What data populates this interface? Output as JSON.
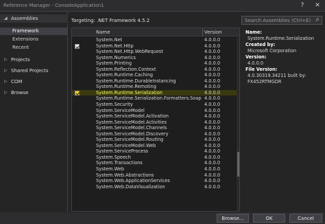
{
  "window": {
    "title": "Reference Manager - ConsoleApplication1",
    "help_glyph": "?",
    "close_glyph": "✕"
  },
  "sidebar": {
    "assemblies": {
      "label": "Assemblies",
      "items": [
        "Framework",
        "Extensions",
        "Recent"
      ],
      "selected": "Framework"
    },
    "groups": [
      "Projects",
      "Shared Projects",
      "COM",
      "Browse"
    ]
  },
  "main": {
    "targeting": "Targeting: .NET Framework 4.5.2",
    "search_placeholder": "Search Assemblies (Ctrl+E)",
    "columns": {
      "name": "Name",
      "version": "Version"
    },
    "rows": [
      {
        "name": "System.Net",
        "version": "4.0.0.0",
        "checked": false,
        "selected": false
      },
      {
        "name": "System.Net.Http",
        "version": "4.0.0.0",
        "checked": true,
        "selected": false
      },
      {
        "name": "System.Net.Http.WebRequest",
        "version": "4.0.0.0",
        "checked": false,
        "selected": false
      },
      {
        "name": "System.Numerics",
        "version": "4.0.0.0",
        "checked": false,
        "selected": false
      },
      {
        "name": "System.Printing",
        "version": "4.0.0.0",
        "checked": false,
        "selected": false
      },
      {
        "name": "System.Reflection.Context",
        "version": "4.0.0.0",
        "checked": false,
        "selected": false
      },
      {
        "name": "System.Runtime.Caching",
        "version": "4.0.0.0",
        "checked": false,
        "selected": false
      },
      {
        "name": "System.Runtime.DurableInstancing",
        "version": "4.0.0.0",
        "checked": false,
        "selected": false
      },
      {
        "name": "System.Runtime.Remoting",
        "version": "4.0.0.0",
        "checked": false,
        "selected": false
      },
      {
        "name": "System.Runtime.Serialization",
        "version": "4.0.0.0",
        "checked": true,
        "selected": true
      },
      {
        "name": "System.Runtime.Serialization.Formatters.Soap",
        "version": "4.0.0.0",
        "checked": false,
        "selected": false
      },
      {
        "name": "System.Security",
        "version": "4.0.0.0",
        "checked": false,
        "selected": false
      },
      {
        "name": "System.ServiceModel",
        "version": "4.0.0.0",
        "checked": false,
        "selected": false
      },
      {
        "name": "System.ServiceModel.Activation",
        "version": "4.0.0.0",
        "checked": false,
        "selected": false
      },
      {
        "name": "System.ServiceModel.Activities",
        "version": "4.0.0.0",
        "checked": false,
        "selected": false
      },
      {
        "name": "System.ServiceModel.Channels",
        "version": "4.0.0.0",
        "checked": false,
        "selected": false
      },
      {
        "name": "System.ServiceModel.Discovery",
        "version": "4.0.0.0",
        "checked": false,
        "selected": false
      },
      {
        "name": "System.ServiceModel.Routing",
        "version": "4.0.0.0",
        "checked": false,
        "selected": false
      },
      {
        "name": "System.ServiceModel.Web",
        "version": "4.0.0.0",
        "checked": false,
        "selected": false
      },
      {
        "name": "System.ServiceProcess",
        "version": "4.0.0.0",
        "checked": false,
        "selected": false
      },
      {
        "name": "System.Speech",
        "version": "4.0.0.0",
        "checked": false,
        "selected": false
      },
      {
        "name": "System.Transactions",
        "version": "4.0.0.0",
        "checked": false,
        "selected": false
      },
      {
        "name": "System.Web",
        "version": "4.0.0.0",
        "checked": false,
        "selected": false
      },
      {
        "name": "System.Web.Abstractions",
        "version": "4.0.0.0",
        "checked": false,
        "selected": false
      },
      {
        "name": "System.Web.ApplicationServices",
        "version": "4.0.0.0",
        "checked": false,
        "selected": false
      },
      {
        "name": "System.Web.DataVisualization",
        "version": "4.0.0.0",
        "checked": false,
        "selected": false
      }
    ]
  },
  "details": {
    "name_label": "Name:",
    "name_value": "System.Runtime.Serialization",
    "created_label": "Created by:",
    "created_value": "Microsoft Corporation",
    "version_label": "Version:",
    "version_value": "4.0.0.0",
    "file_version_label": "File Version:",
    "file_version_value": "4.0.30319.34211 built by:",
    "file_version_value2": "FX452RTMGDR"
  },
  "footer": {
    "browse": "Browse...",
    "ok": "OK",
    "cancel": "Cancel"
  }
}
